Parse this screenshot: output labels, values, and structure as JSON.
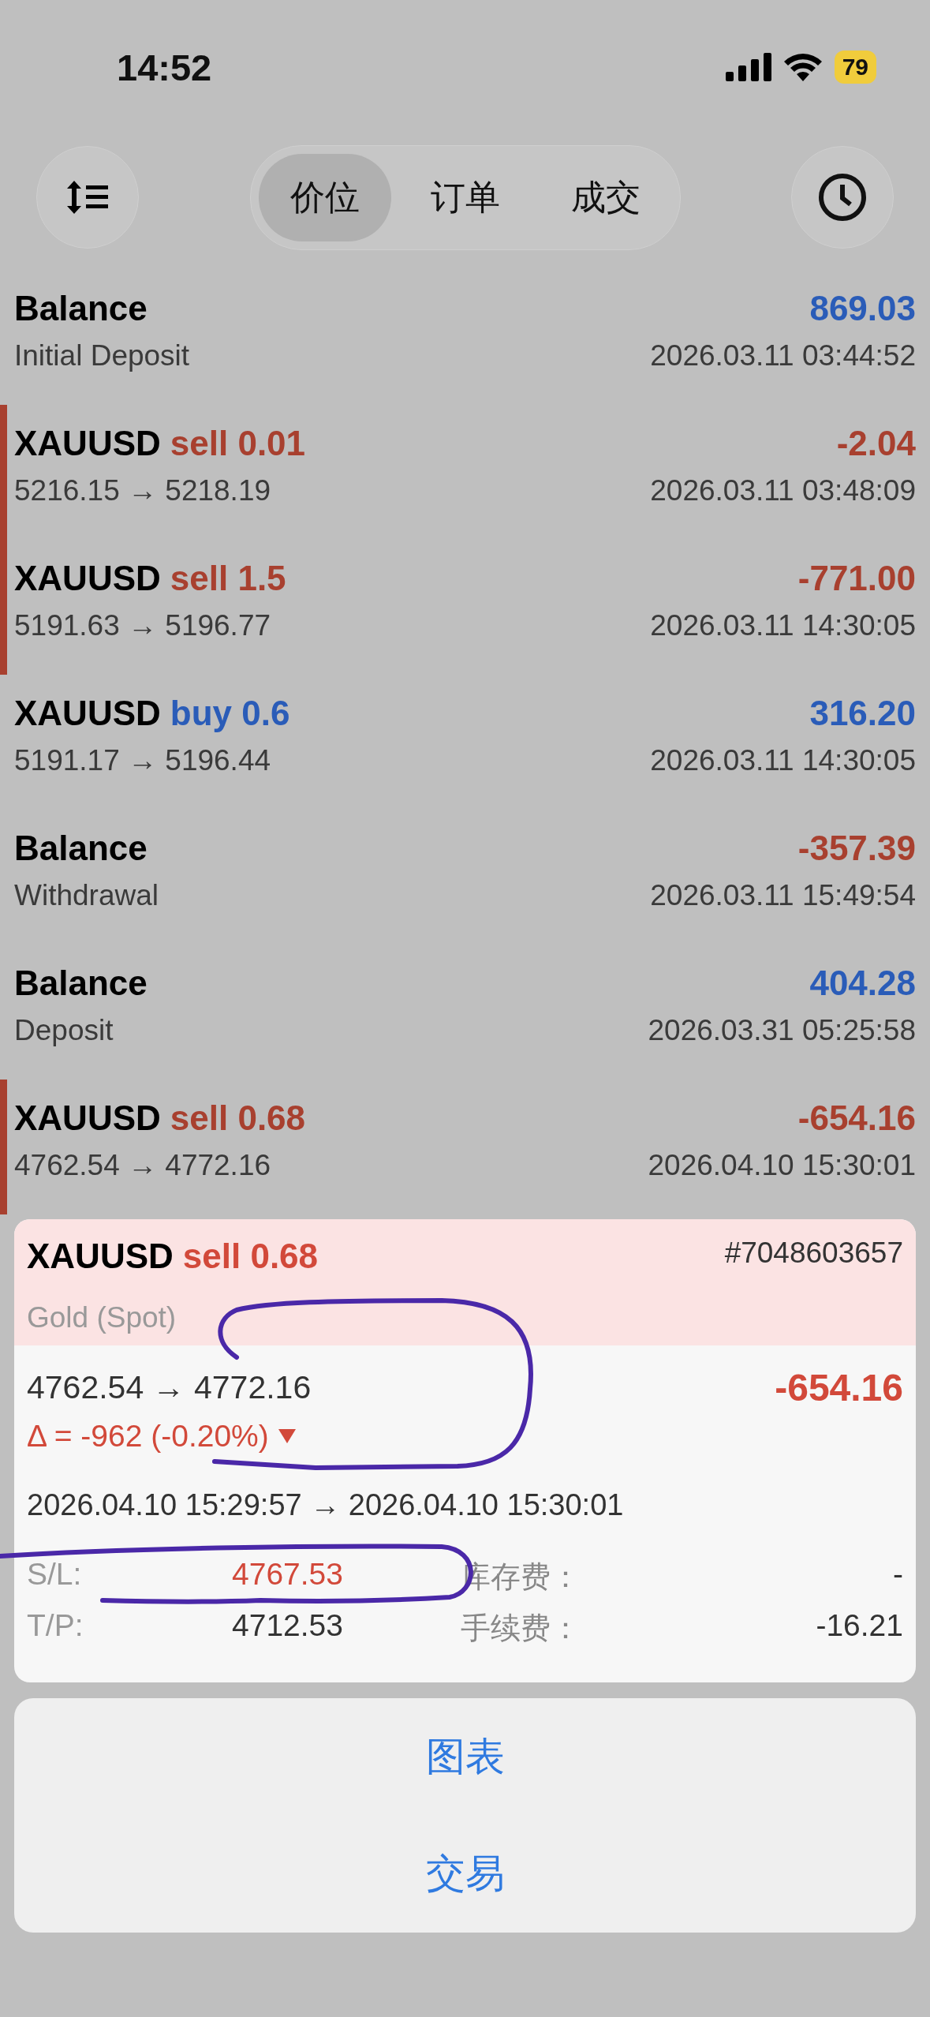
{
  "status_bar": {
    "time": "14:52",
    "battery": "79"
  },
  "toolbar": {
    "tabs": [
      {
        "label": "价位",
        "selected": true
      },
      {
        "label": "订单",
        "selected": false
      },
      {
        "label": "成交",
        "selected": false
      }
    ]
  },
  "deals": [
    {
      "kind": "balance",
      "title": "Balance",
      "amount": "869.03",
      "loss": false,
      "subtitle": "Initial Deposit",
      "time": "2026.03.11 03:44:52"
    },
    {
      "kind": "sell",
      "title": "XAUUSD",
      "order": "sell 0.01",
      "amount": "-2.04",
      "loss": true,
      "subtitle": "5216.15 → 5218.19",
      "time": "2026.03.11 03:48:09"
    },
    {
      "kind": "sell",
      "title": "XAUUSD",
      "order": "sell 1.5",
      "amount": "-771.00",
      "loss": true,
      "subtitle": "5191.63 → 5196.77",
      "time": "2026.03.11 14:30:05"
    },
    {
      "kind": "buy",
      "title": "XAUUSD",
      "order": "buy 0.6",
      "amount": "316.20",
      "loss": false,
      "subtitle": "5191.17 → 5196.44",
      "time": "2026.03.11 14:30:05"
    },
    {
      "kind": "balance",
      "title": "Balance",
      "amount": "-357.39",
      "loss": true,
      "subtitle": "Withdrawal",
      "time": "2026.03.11 15:49:54"
    },
    {
      "kind": "balance",
      "title": "Balance",
      "amount": "404.28",
      "loss": false,
      "subtitle": "Deposit",
      "time": "2026.03.31 05:25:58"
    },
    {
      "kind": "sell",
      "title": "XAUUSD",
      "order": "sell 0.68",
      "amount": "-654.16",
      "loss": true,
      "subtitle": "4762.54 → 4772.16",
      "time": "2026.04.10 15:30:01"
    }
  ],
  "detail": {
    "kind": "sell",
    "symbol": "XAUUSD",
    "order": "sell 0.68",
    "name": "Gold (Spot)",
    "ticket": "#7048603657",
    "prices": "4762.54 → 4772.16",
    "profit": "-654.16",
    "delta": "Δ = -962 (-0.20%)",
    "times": "2026.04.10 15:29:57 → 2026.04.10 15:30:01",
    "rows": [
      {
        "label": "S/L:",
        "value": "4767.53",
        "highlight": true,
        "fee_label": "库存费：",
        "fee_value": "-"
      },
      {
        "label": "T/P:",
        "value": "4712.53",
        "highlight": false,
        "fee_label": "手续费：",
        "fee_value": "-16.21"
      }
    ]
  },
  "actions": [
    "图表",
    "交易"
  ]
}
